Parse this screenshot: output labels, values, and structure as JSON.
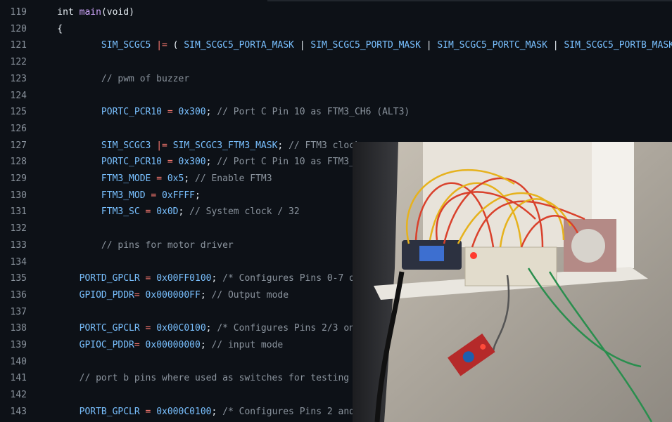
{
  "editor": {
    "lines": [
      {
        "n": "119",
        "tokens": [
          [
            "pl",
            "    int "
          ],
          [
            "fn",
            "main"
          ],
          [
            "pl",
            "(void)"
          ]
        ]
      },
      {
        "n": "120",
        "tokens": [
          [
            "pl",
            "    {"
          ]
        ]
      },
      {
        "n": "121",
        "tokens": [
          [
            "id",
            "            SIM_SCGC5"
          ],
          [
            "pl",
            " "
          ],
          [
            "op",
            "|="
          ],
          [
            "pl",
            " ( "
          ],
          [
            "id",
            "SIM_SCGC5_PORTA_MASK"
          ],
          [
            "pl",
            " | "
          ],
          [
            "id",
            "SIM_SCGC5_PORTD_MASK"
          ],
          [
            "pl",
            " | "
          ],
          [
            "id",
            "SIM_SCGC5_PORTC_MASK"
          ],
          [
            "pl",
            " | "
          ],
          [
            "id",
            "SIM_SCGC5_PORTB_MASK"
          ]
        ]
      },
      {
        "n": "122",
        "tokens": []
      },
      {
        "n": "123",
        "tokens": [
          [
            "cm",
            "            // pwm of buzzer"
          ]
        ]
      },
      {
        "n": "124",
        "tokens": []
      },
      {
        "n": "125",
        "tokens": [
          [
            "id",
            "            PORTC_PCR10"
          ],
          [
            "pl",
            " "
          ],
          [
            "op",
            "="
          ],
          [
            "pl",
            " "
          ],
          [
            "num",
            "0x300"
          ],
          [
            "pl",
            "; "
          ],
          [
            "cm",
            "// Port C Pin 10 as FTM3_CH6 (ALT3)"
          ]
        ]
      },
      {
        "n": "126",
        "tokens": []
      },
      {
        "n": "127",
        "tokens": [
          [
            "id",
            "            SIM_SCGC3"
          ],
          [
            "pl",
            " "
          ],
          [
            "op",
            "|="
          ],
          [
            "pl",
            " "
          ],
          [
            "id",
            "SIM_SCGC3_FTM3_MASK"
          ],
          [
            "pl",
            "; "
          ],
          [
            "cm",
            "// FTM3 clock"
          ]
        ]
      },
      {
        "n": "128",
        "tokens": [
          [
            "id",
            "            PORTC_PCR10"
          ],
          [
            "pl",
            " "
          ],
          [
            "op",
            "="
          ],
          [
            "pl",
            " "
          ],
          [
            "num",
            "0x300"
          ],
          [
            "pl",
            "; "
          ],
          [
            "cm",
            "// Port C Pin 10 as FTM3_"
          ]
        ]
      },
      {
        "n": "129",
        "tokens": [
          [
            "id",
            "            FTM3_MODE"
          ],
          [
            "pl",
            " "
          ],
          [
            "op",
            "="
          ],
          [
            "pl",
            " "
          ],
          [
            "num",
            "0x5"
          ],
          [
            "pl",
            "; "
          ],
          [
            "cm",
            "// Enable FTM3"
          ]
        ]
      },
      {
        "n": "130",
        "tokens": [
          [
            "id",
            "            FTM3_MOD"
          ],
          [
            "pl",
            " "
          ],
          [
            "op",
            "="
          ],
          [
            "pl",
            " "
          ],
          [
            "num",
            "0xFFFF"
          ],
          [
            "pl",
            ";"
          ]
        ]
      },
      {
        "n": "131",
        "tokens": [
          [
            "id",
            "            FTM3_SC"
          ],
          [
            "pl",
            " "
          ],
          [
            "op",
            "="
          ],
          [
            "pl",
            " "
          ],
          [
            "num",
            "0x0D"
          ],
          [
            "pl",
            "; "
          ],
          [
            "cm",
            "// System clock / 32"
          ]
        ]
      },
      {
        "n": "132",
        "tokens": []
      },
      {
        "n": "133",
        "tokens": [
          [
            "cm",
            "            // pins for motor driver"
          ]
        ]
      },
      {
        "n": "134",
        "tokens": []
      },
      {
        "n": "135",
        "tokens": [
          [
            "id",
            "        PORTD_GPCLR"
          ],
          [
            "pl",
            " "
          ],
          [
            "op",
            "="
          ],
          [
            "pl",
            " "
          ],
          [
            "num",
            "0x00FF0100"
          ],
          [
            "pl",
            "; "
          ],
          [
            "cm",
            "/* Configures Pins 0-7 o"
          ]
        ]
      },
      {
        "n": "136",
        "tokens": [
          [
            "id",
            "        GPIOD_PDDR"
          ],
          [
            "op",
            "="
          ],
          [
            "pl",
            " "
          ],
          [
            "num",
            "0x000000FF"
          ],
          [
            "pl",
            "; "
          ],
          [
            "cm",
            "// Output mode"
          ]
        ]
      },
      {
        "n": "137",
        "tokens": []
      },
      {
        "n": "138",
        "tokens": [
          [
            "id",
            "        PORTC_GPCLR"
          ],
          [
            "pl",
            " "
          ],
          [
            "op",
            "="
          ],
          [
            "pl",
            " "
          ],
          [
            "num",
            "0x00C0100"
          ],
          [
            "pl",
            "; "
          ],
          [
            "cm",
            "/* Configures Pins 2/3 on"
          ]
        ]
      },
      {
        "n": "139",
        "tokens": [
          [
            "id",
            "        GPIOC_PDDR"
          ],
          [
            "op",
            "="
          ],
          [
            "pl",
            " "
          ],
          [
            "num",
            "0x00000000"
          ],
          [
            "pl",
            "; "
          ],
          [
            "cm",
            "// input mode"
          ]
        ]
      },
      {
        "n": "140",
        "tokens": []
      },
      {
        "n": "141",
        "tokens": [
          [
            "cm",
            "        // port b pins where used as switches for testing"
          ]
        ]
      },
      {
        "n": "142",
        "tokens": []
      },
      {
        "n": "143",
        "tokens": [
          [
            "id",
            "        PORTB_GPCLR"
          ],
          [
            "pl",
            " "
          ],
          [
            "op",
            "="
          ],
          [
            "pl",
            " "
          ],
          [
            "num",
            "0x000C0100"
          ],
          [
            "pl",
            "; "
          ],
          [
            "cm",
            "/* Configures Pins 2 and"
          ]
        ]
      }
    ]
  },
  "photo": {
    "subject": "breadboard-circuit-photo"
  }
}
